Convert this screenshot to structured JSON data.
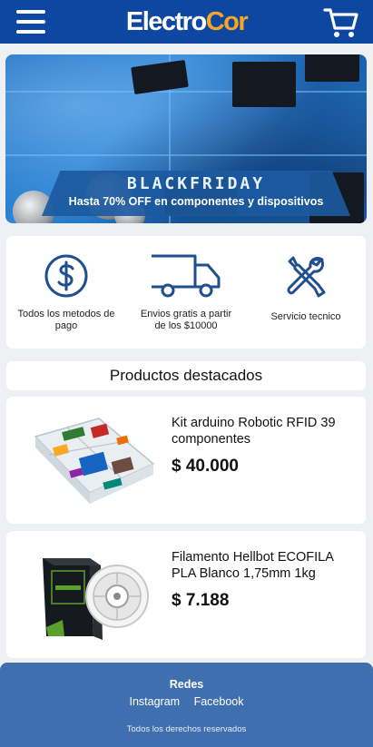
{
  "header": {
    "logo_part1": "Electro",
    "logo_part2": "Cor",
    "menu_icon": "hamburger-menu-icon",
    "cart_icon": "shopping-cart-icon"
  },
  "banner": {
    "title": "BLACKFRIDAY",
    "subtitle": "Hasta 70% OFF en componentes  y dispositivos"
  },
  "services": [
    {
      "icon": "dollar-circle-icon",
      "label": "Todos los metodos de pago"
    },
    {
      "icon": "delivery-truck-icon",
      "label": "Envios gratis a partir de los $10000"
    },
    {
      "icon": "tools-icon",
      "label": "Servicio tecnico"
    }
  ],
  "featured_title": "Productos destacados",
  "products": [
    {
      "name": "Kit arduino Robotic RFID 39 componentes",
      "price": "$ 40.000"
    },
    {
      "name": "Filamento Hellbot ECOFILA PLA Blanco 1,75mm 1kg",
      "price": "$ 7.188"
    }
  ],
  "footer": {
    "title": "Redes",
    "links": [
      "Instagram",
      "Facebook"
    ],
    "copyright": "Todos los derechos reservados"
  },
  "colors": {
    "header_bg": "#0d47a1",
    "logo_accent": "#f5a623",
    "icon_blue": "#1f4f8f",
    "footer_bg": "#3f6fae"
  }
}
